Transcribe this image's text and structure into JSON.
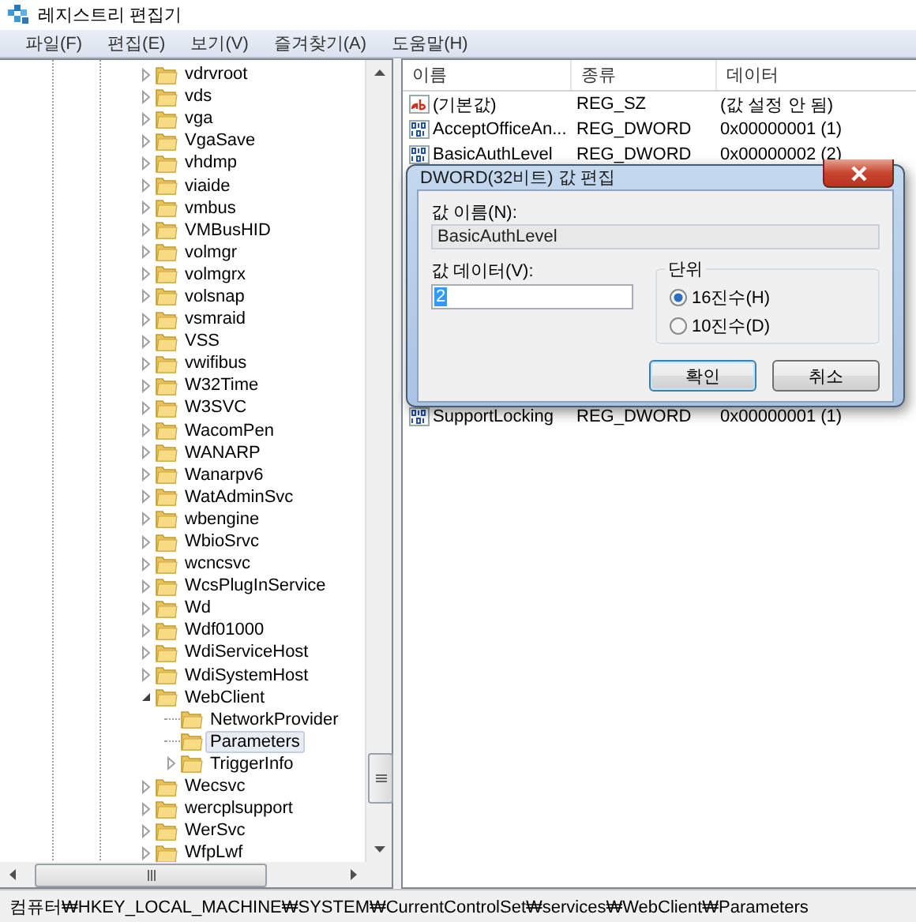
{
  "window": {
    "title": "레지스트리 편집기"
  },
  "menu": [
    {
      "label": "파일(F)"
    },
    {
      "label": "편집(E)"
    },
    {
      "label": "보기(V)"
    },
    {
      "label": "즐겨찾기(A)"
    },
    {
      "label": "도움말(H)"
    }
  ],
  "tree": {
    "items": [
      {
        "label": "vdrvroot",
        "expandable": true,
        "expanded": false,
        "selected": false
      },
      {
        "label": "vds",
        "expandable": true,
        "expanded": false,
        "selected": false
      },
      {
        "label": "vga",
        "expandable": true,
        "expanded": false,
        "selected": false
      },
      {
        "label": "VgaSave",
        "expandable": true,
        "expanded": false,
        "selected": false
      },
      {
        "label": "vhdmp",
        "expandable": true,
        "expanded": false,
        "selected": false
      },
      {
        "label": "viaide",
        "expandable": true,
        "expanded": false,
        "selected": false
      },
      {
        "label": "vmbus",
        "expandable": true,
        "expanded": false,
        "selected": false
      },
      {
        "label": "VMBusHID",
        "expandable": true,
        "expanded": false,
        "selected": false
      },
      {
        "label": "volmgr",
        "expandable": true,
        "expanded": false,
        "selected": false
      },
      {
        "label": "volmgrx",
        "expandable": true,
        "expanded": false,
        "selected": false
      },
      {
        "label": "volsnap",
        "expandable": true,
        "expanded": false,
        "selected": false
      },
      {
        "label": "vsmraid",
        "expandable": true,
        "expanded": false,
        "selected": false
      },
      {
        "label": "VSS",
        "expandable": true,
        "expanded": false,
        "selected": false
      },
      {
        "label": "vwifibus",
        "expandable": true,
        "expanded": false,
        "selected": false
      },
      {
        "label": "W32Time",
        "expandable": true,
        "expanded": false,
        "selected": false
      },
      {
        "label": "W3SVC",
        "expandable": true,
        "expanded": false,
        "selected": false
      },
      {
        "label": "WacomPen",
        "expandable": true,
        "expanded": false,
        "selected": false
      },
      {
        "label": "WANARP",
        "expandable": true,
        "expanded": false,
        "selected": false
      },
      {
        "label": "Wanarpv6",
        "expandable": true,
        "expanded": false,
        "selected": false
      },
      {
        "label": "WatAdminSvc",
        "expandable": true,
        "expanded": false,
        "selected": false
      },
      {
        "label": "wbengine",
        "expandable": true,
        "expanded": false,
        "selected": false
      },
      {
        "label": "WbioSrvc",
        "expandable": true,
        "expanded": false,
        "selected": false
      },
      {
        "label": "wcncsvc",
        "expandable": true,
        "expanded": false,
        "selected": false
      },
      {
        "label": "WcsPlugInService",
        "expandable": true,
        "expanded": false,
        "selected": false
      },
      {
        "label": "Wd",
        "expandable": true,
        "expanded": false,
        "selected": false
      },
      {
        "label": "Wdf01000",
        "expandable": true,
        "expanded": false,
        "selected": false
      },
      {
        "label": "WdiServiceHost",
        "expandable": true,
        "expanded": false,
        "selected": false
      },
      {
        "label": "WdiSystemHost",
        "expandable": true,
        "expanded": false,
        "selected": false
      },
      {
        "label": "WebClient",
        "expandable": true,
        "expanded": true,
        "selected": false,
        "children": [
          {
            "label": "NetworkProvider",
            "expandable": false,
            "selected": false
          },
          {
            "label": "Parameters",
            "expandable": false,
            "selected": true
          },
          {
            "label": "TriggerInfo",
            "expandable": true,
            "expanded": false,
            "selected": false
          }
        ]
      },
      {
        "label": "Wecsvc",
        "expandable": true,
        "expanded": false,
        "selected": false
      },
      {
        "label": "wercplsupport",
        "expandable": true,
        "expanded": false,
        "selected": false
      },
      {
        "label": "WerSvc",
        "expandable": true,
        "expanded": false,
        "selected": false
      },
      {
        "label": "WfpLwf",
        "expandable": true,
        "expanded": false,
        "selected": false
      }
    ]
  },
  "values": {
    "columns": [
      {
        "label": "이름"
      },
      {
        "label": "종류"
      },
      {
        "label": "데이터"
      }
    ],
    "rows": [
      {
        "kind": "string",
        "name": "(기본값)",
        "type": "REG_SZ",
        "data": "(값 설정 안 됨)"
      },
      {
        "kind": "binary",
        "name": "AcceptOfficeAn...",
        "type": "REG_DWORD",
        "data": "0x00000001 (1)"
      },
      {
        "kind": "binary",
        "name": "BasicAuthLevel",
        "type": "REG_DWORD",
        "data": "0x00000002 (2)"
      },
      {
        "kind": "hidden"
      },
      {
        "kind": "binary",
        "name": "SupportLocking",
        "type": "REG_DWORD",
        "data": "0x00000001 (1)"
      }
    ]
  },
  "dialog": {
    "title": "DWORD(32비트) 값 편집",
    "name_label": "값 이름(N):",
    "name_value": "BasicAuthLevel",
    "data_label": "값 데이터(V):",
    "data_value": "2",
    "base_label": "단위",
    "radios": [
      {
        "label": "16진수(H)",
        "selected": true
      },
      {
        "label": "10진수(D)",
        "selected": false
      }
    ],
    "buttons": [
      {
        "label": "확인",
        "default": true
      },
      {
        "label": "취소",
        "default": false
      }
    ]
  },
  "status_bar": "컴퓨터₩HKEY_LOCAL_MACHINE₩SYSTEM₩CurrentControlSet₩services₩WebClient₩Parameters"
}
